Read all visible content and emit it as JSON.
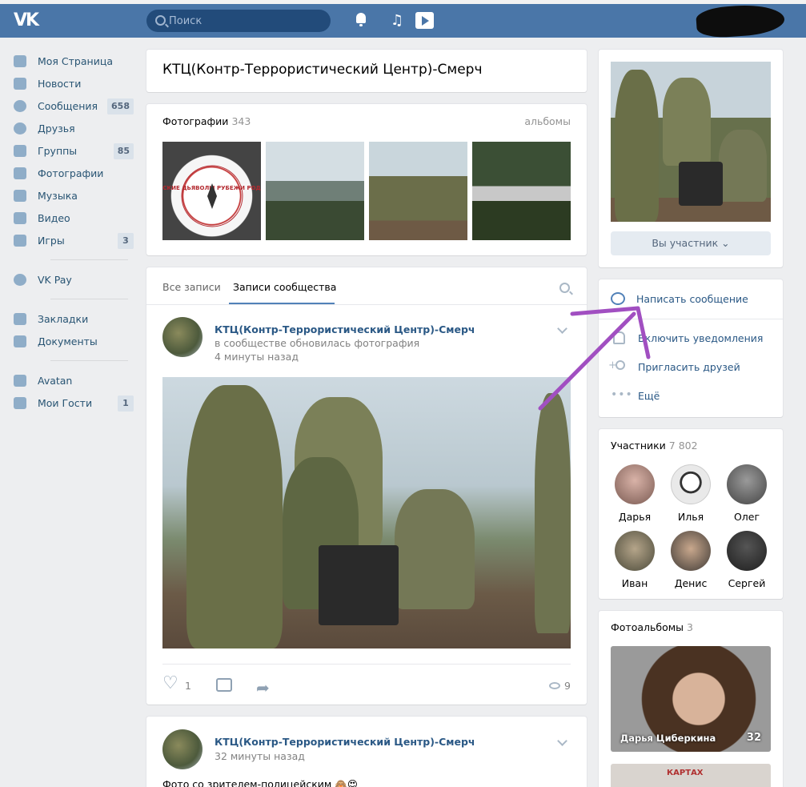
{
  "header": {
    "logo": "VK",
    "search_placeholder": "Поиск"
  },
  "nav": {
    "items": [
      {
        "label": "Моя Страница"
      },
      {
        "label": "Новости"
      },
      {
        "label": "Сообщения",
        "count": "658"
      },
      {
        "label": "Друзья"
      },
      {
        "label": "Группы",
        "count": "85"
      },
      {
        "label": "Фотографии"
      },
      {
        "label": "Музыка"
      },
      {
        "label": "Видео"
      },
      {
        "label": "Игры",
        "count": "3"
      }
    ],
    "pay": "VK Pay",
    "extra": [
      {
        "label": "Закладки"
      },
      {
        "label": "Документы"
      }
    ],
    "apps": [
      {
        "label": "Avatan"
      },
      {
        "label": "Мои Гости",
        "count": "1"
      }
    ]
  },
  "group": {
    "title": "КТЦ(Контр-Террористический Центр)-Смерч",
    "member_button": "Вы участник ⌄"
  },
  "photos": {
    "label": "Фотографии",
    "count": "343",
    "albums_link": "альбомы",
    "thumb1_text": "МОРСКИЕ ДЬЯВОЛЫ РУБЕЖИ РОДИНЫ"
  },
  "feed": {
    "tabs": [
      "Все записи",
      "Записи сообщества"
    ],
    "post1": {
      "author": "КТЦ(Контр-Террористический Центр)-Смерч",
      "subtitle": "в сообществе обновилась фотография",
      "time": "4 минуты назад",
      "likes": "1",
      "views": "9"
    },
    "post2": {
      "author": "КТЦ(Контр-Террористический Центр)-Смерч",
      "time": "32 минуты назад",
      "text": "Фото со зрителем-полицейским"
    }
  },
  "actions": {
    "write": "Написать сообщение",
    "notify": "Включить уведомления",
    "invite": "Пригласить друзей",
    "more": "Ещё"
  },
  "members": {
    "label": "Участники",
    "count": "7 802",
    "list": [
      {
        "name": "Дарья"
      },
      {
        "name": "Илья"
      },
      {
        "name": "Олег"
      },
      {
        "name": "Иван"
      },
      {
        "name": "Денис"
      },
      {
        "name": "Сергей"
      }
    ]
  },
  "albums": {
    "label": "Фотоальбомы",
    "count": "3",
    "first_name": "Дарья Циберкина",
    "first_count": "32",
    "second_text": "КАРТАХ"
  },
  "colors": {
    "header": "#4a76a8",
    "link": "#2a5885",
    "annotation_arrow": "#a14fc1"
  }
}
